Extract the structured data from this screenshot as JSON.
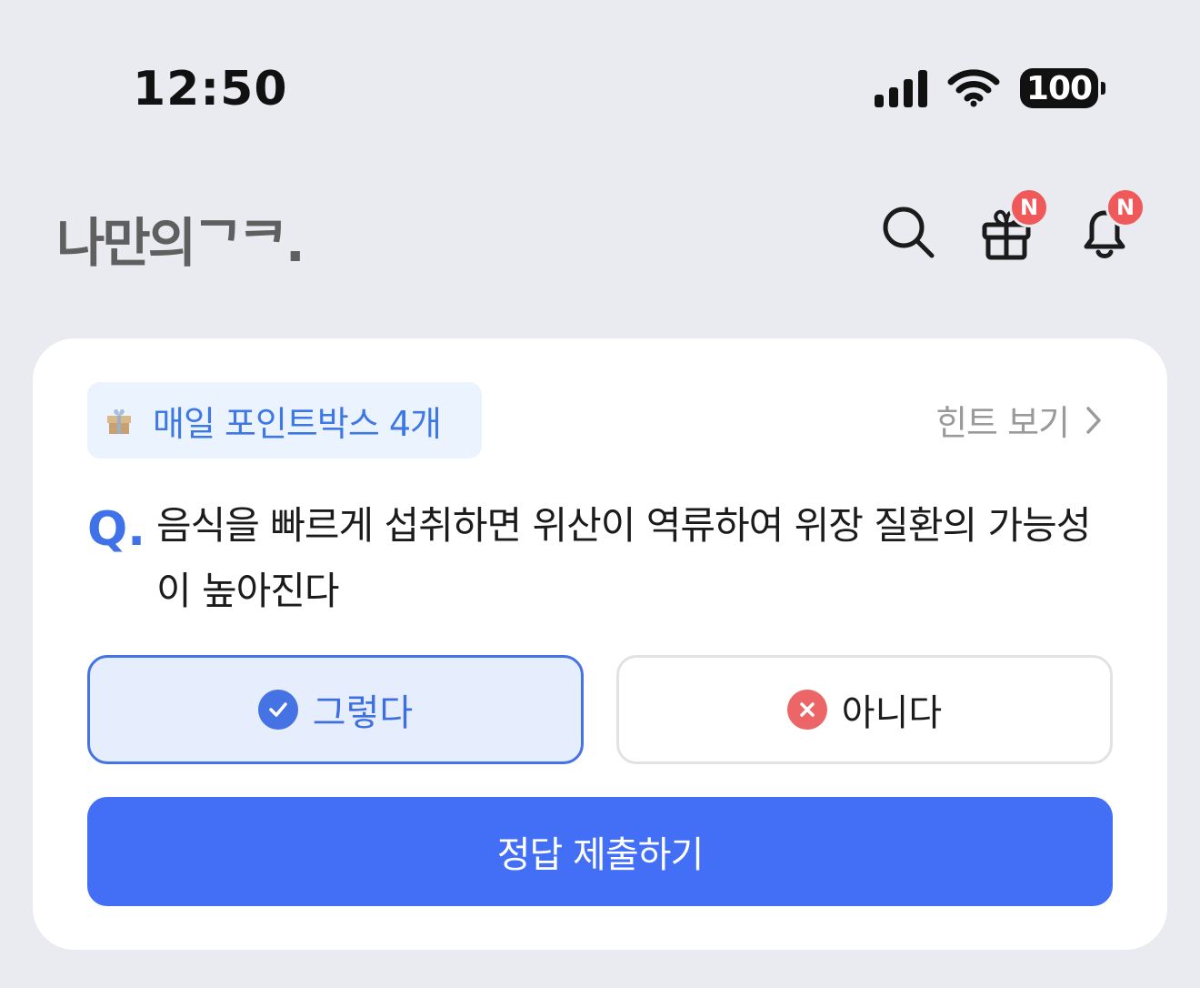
{
  "status_bar": {
    "time": "12:50",
    "battery": "100",
    "icons": [
      "signal-icon",
      "wifi-icon",
      "battery-icon"
    ]
  },
  "header": {
    "logo": "나만의ᄀᄏ.",
    "icons": [
      {
        "name": "search-icon"
      },
      {
        "name": "gift-icon",
        "badge": "N"
      },
      {
        "name": "bell-icon",
        "badge": "N"
      }
    ]
  },
  "card": {
    "points_chip": {
      "icon": "gift-emoji-icon",
      "label": "매일 포인트박스 4개"
    },
    "hint_link": "힌트 보기",
    "question": {
      "mark": "Q.",
      "text": "음식을 빠르게 섭취하면 위산이 역류하여 위장 질환의 가능성이 높아진다"
    },
    "answers": [
      {
        "label": "그렇다",
        "icon": "check-circle-icon",
        "selected": true
      },
      {
        "label": "아니다",
        "icon": "x-circle-icon",
        "selected": false
      }
    ],
    "submit_label": "정답 제출하기"
  },
  "colors": {
    "background": "#e9ebf0",
    "card": "#ffffff",
    "primary": "#436ff6",
    "selected_border": "#4573e4",
    "selected_bg": "#e6eefd",
    "badge": "#f0595a",
    "reject": "#ec6667"
  }
}
